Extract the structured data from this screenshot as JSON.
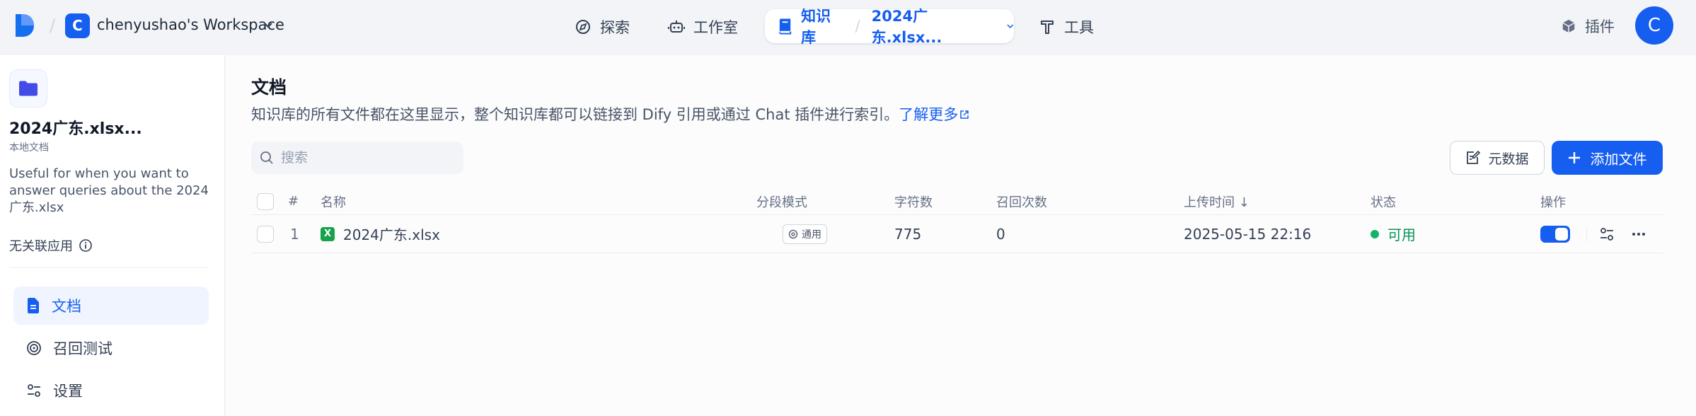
{
  "header": {
    "workspace_initial": "C",
    "workspace_name": "chenyushao's Workspace",
    "nav": {
      "explore": "探索",
      "studio": "工作室",
      "knowledge": "知识库",
      "dataset_name": "2024广东.xlsx...",
      "tools": "工具"
    },
    "plugins": "插件",
    "avatar_initial": "C"
  },
  "sidebar": {
    "kb_name": "2024广东.xlsx...",
    "kb_type": "本地文档",
    "kb_description": "Useful for when you want to answer queries about the 2024广东.xlsx",
    "linked_apps": "无关联应用",
    "menu": {
      "documents": "文档",
      "retrieval_test": "召回测试",
      "settings": "设置"
    }
  },
  "main": {
    "title": "文档",
    "description": "知识库的所有文件都在这里显示，整个知识库都可以链接到 Dify 引用或通过 Chat 插件进行索引。",
    "learn_more": "了解更多",
    "search_placeholder": "搜索",
    "metadata_button": "元数据",
    "add_file_button": "添加文件",
    "table": {
      "headers": {
        "index": "#",
        "name": "名称",
        "chunk_mode": "分段模式",
        "chars": "字符数",
        "hits": "召回次数",
        "upload_time": "上传时间 ↓",
        "status": "状态",
        "actions": "操作"
      },
      "rows": [
        {
          "index": "1",
          "name": "2024广东.xlsx",
          "chunk_mode": "通用",
          "chars": "775",
          "hits": "0",
          "upload_time": "2025-05-15 22:16",
          "status": "可用",
          "enabled": true
        }
      ]
    }
  },
  "colors": {
    "primary": "#155eef",
    "success": "#17b26a",
    "excel": "#16a34a"
  }
}
